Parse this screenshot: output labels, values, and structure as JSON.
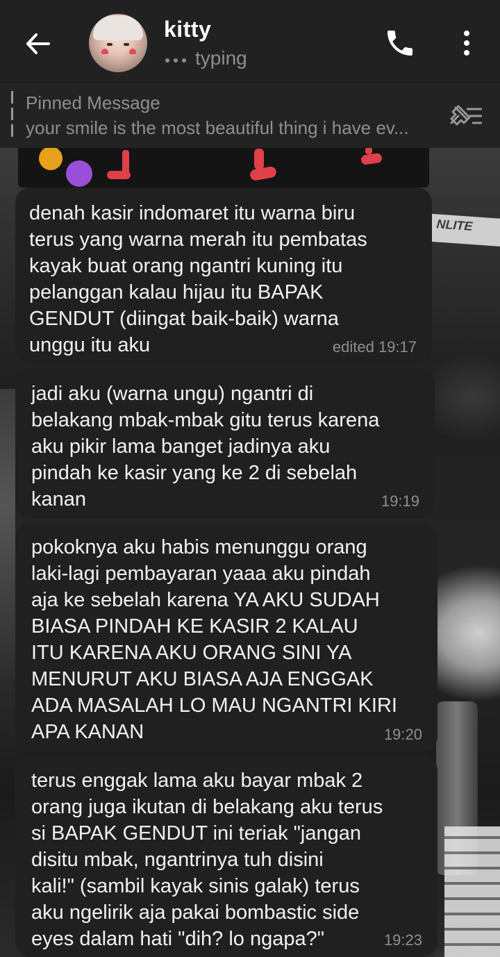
{
  "header": {
    "contact_name": "kitty",
    "status": "typing",
    "back_icon": "arrow-left-icon",
    "call_icon": "phone-icon",
    "menu_icon": "more-vertical-icon"
  },
  "pinned": {
    "title": "Pinned Message",
    "text": "your smile is the most beautiful thing i have ev...",
    "icon": "pin-list-icon"
  },
  "messages": [
    {
      "text": "denah kasir indomaret itu warna biru\nterus yang warna merah itu pembatas\nkayak buat orang ngantri kuning itu\npelanggan kalau hijau itu BAPAK\nGENDUT (diingat baik-baik) warna\nunggu itu aku",
      "time": "edited 19:17"
    },
    {
      "text": "jadi aku (warna ungu) ngantri di\nbelakang mbak-mbak gitu terus karena\naku pikir lama banget jadinya aku\npindah ke kasir yang ke 2 di sebelah\nkanan",
      "time": "19:19"
    },
    {
      "text": "pokoknya aku habis menunggu orang\nlaki-lagi pembayaran yaaa aku pindah\naja ke sebelah karena YA AKU SUDAH\nBIASA PINDAH KE KASIR 2 KALAU\nITU KARENA AKU ORANG SINI YA\nMENURUT AKU BIASA AJA ENGGAK\nADA MASALAH LO MAU NGANTRI KIRI\nAPA KANAN",
      "time": "19:20"
    },
    {
      "text": "terus enggak lama aku bayar mbak 2\norang juga ikutan di belakang aku terus\nsi BAPAK GENDUT ini teriak \"jangan\ndisitu mbak, ngantrinya tuh disini\nkali!\" (sambil kayak sinis galak) terus\naku ngelirik aja pakai bombastic side\neyes dalam hati \"dih? lo ngapa?\"",
      "time": "19:23"
    }
  ],
  "wallpaper": {
    "sign_text": "NLITE"
  },
  "colors": {
    "header_bg": "#212121",
    "bubble_bg": "#202020",
    "text": "#f2f2f2",
    "muted": "#8f8f8f",
    "dot_orange": "#e8a11c",
    "dot_purple": "#9b4fd8",
    "mark_red": "#e0404a"
  }
}
